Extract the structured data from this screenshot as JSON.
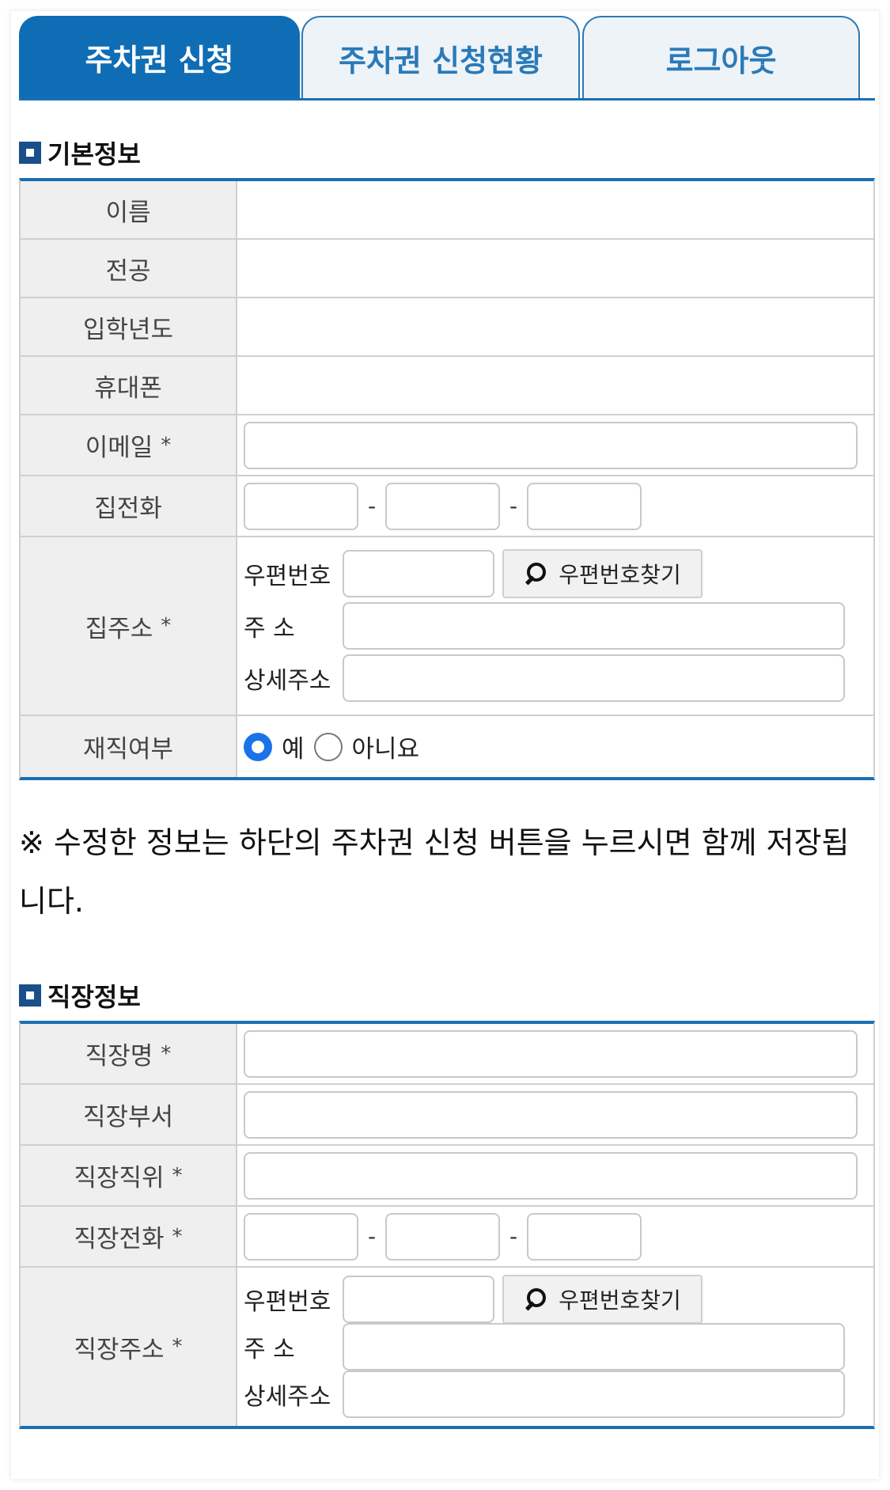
{
  "tabs": [
    {
      "label": "주차권 신청",
      "active": true
    },
    {
      "label": "주차권 신청현황",
      "active": false
    },
    {
      "label": "로그아웃",
      "active": false
    }
  ],
  "basic": {
    "title": "기본정보",
    "name_label": "이름",
    "major_label": "전공",
    "year_label": "입학년도",
    "mobile_label": "휴대폰",
    "email_label": "이메일",
    "home_phone_label": "집전화",
    "home_address_label": "집주소",
    "employed_label": "재직여부",
    "required_mark": "*",
    "phone_dash": "-",
    "zip_label": "우편번호",
    "zip_button": "우편번호찾기",
    "address_label": "주 소",
    "detail_label": "상세주소",
    "radio_yes": "예",
    "radio_no": "아니요",
    "selected": "예"
  },
  "notice": "※ 수정한 정보는 하단의 주차권 신청 버튼을 누르시면 함께 저장됩니다.",
  "work": {
    "title": "직장정보",
    "company_label": "직장명",
    "dept_label": "직장부서",
    "position_label": "직장직위",
    "phone_label": "직장전화",
    "address_label": "직장주소",
    "required_mark": "*",
    "phone_dash": "-",
    "zip_label": "우편번호",
    "zip_button": "우편번호찾기",
    "addr_label": "주 소",
    "detail_label": "상세주소"
  },
  "colors": {
    "accent": "#0f6db5",
    "radio_checked": "#1a73e8"
  }
}
